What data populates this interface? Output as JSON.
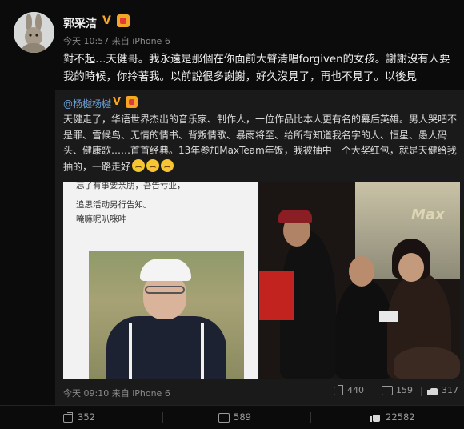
{
  "post": {
    "author": "郭采洁",
    "meta": "今天 10:57 来自 iPhone 6",
    "text": "對不起…天健哥。我永遠是那個在你面前大聲清唱forgiven的女孩。謝謝沒有人要我的時候，你拎著我。以前說很多謝謝，好久沒見了，再也不見了。以後見"
  },
  "repost": {
    "author": "@杨樾杨樾",
    "text": "天健走了，华语世界杰出的音乐家、制作人，一位作品比本人更有名的幕后英雄。男人哭吧不是罪、雪候鸟、无情的情书、背叛情歌、暴雨将至、给所有知道我名字的人、恒星、愚人码头、健康歌……首首经典。13年参加MaxTeam年饭，我被抽中一个大奖红包，就是天健给我抽的，一路走好",
    "image_left_lines": [
      "忘了有事要亲朋，吾告亏亚，",
      "追思活动另行告知。",
      "唵嘛呢叭咪吽"
    ],
    "stage_text": "Max",
    "meta": "今天 09:10 来自 iPhone 6",
    "shares": "440",
    "comments": "159",
    "likes": "317"
  },
  "footer": {
    "shares": "352",
    "comments": "589",
    "likes": "22582"
  },
  "icons": {
    "verified": "V",
    "share": "share-icon",
    "comment": "comment-icon",
    "like": "thumbs-up-icon"
  },
  "colors": {
    "background": "#0b0b0b",
    "link": "#6f9fd8",
    "verified": "#f5a623"
  }
}
